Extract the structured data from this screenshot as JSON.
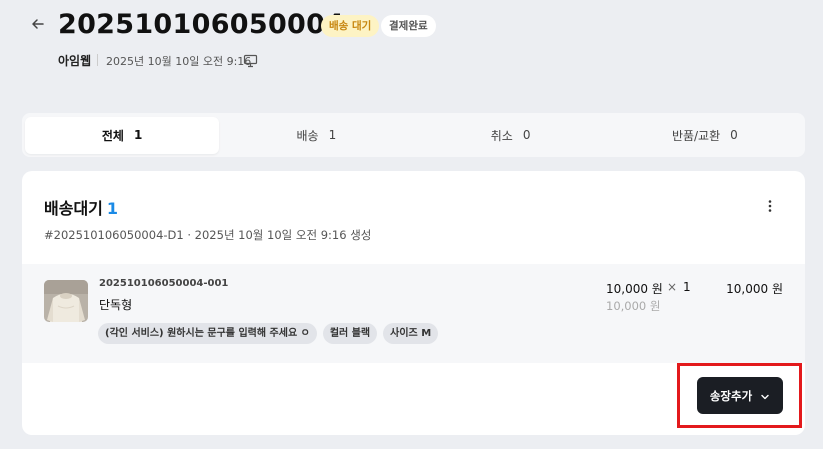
{
  "header": {
    "order_number": "202510106050004",
    "badges": {
      "status": "배송 대기",
      "payment": "결제완료"
    },
    "seller": "아임웹",
    "created_at": "2025년 10월 10일 오전 9:16"
  },
  "tabs": [
    {
      "label": "전체",
      "count": "1",
      "active": true
    },
    {
      "label": "배송",
      "count": "1",
      "active": false
    },
    {
      "label": "취소",
      "count": "0",
      "active": false
    },
    {
      "label": "반품/교환",
      "count": "0",
      "active": false
    }
  ],
  "shipment": {
    "title": "배송대기",
    "count": "1",
    "meta": "#202510106050004-D1 · 2025년 10월 10일 오전 9:16 생성",
    "item": {
      "code": "202510106050004-001",
      "name": "단독형",
      "options": [
        "(각인 서비스) 원하시는 문구를 입력해 주세요 ㅇ",
        "컬러 블랙",
        "사이즈 M"
      ],
      "unit_price": "10,000 원",
      "times": "×",
      "quantity": "1",
      "original_price": "10,000 원",
      "line_total": "10,000 원"
    },
    "add_tracking_label": "송장추가"
  },
  "colors": {
    "accent_blue": "#1a8ae6",
    "badge_wait_bg": "#fdf3c4",
    "badge_wait_text": "#c7860f",
    "highlight_red": "#e3191c",
    "button_dark": "#1b1e24"
  }
}
